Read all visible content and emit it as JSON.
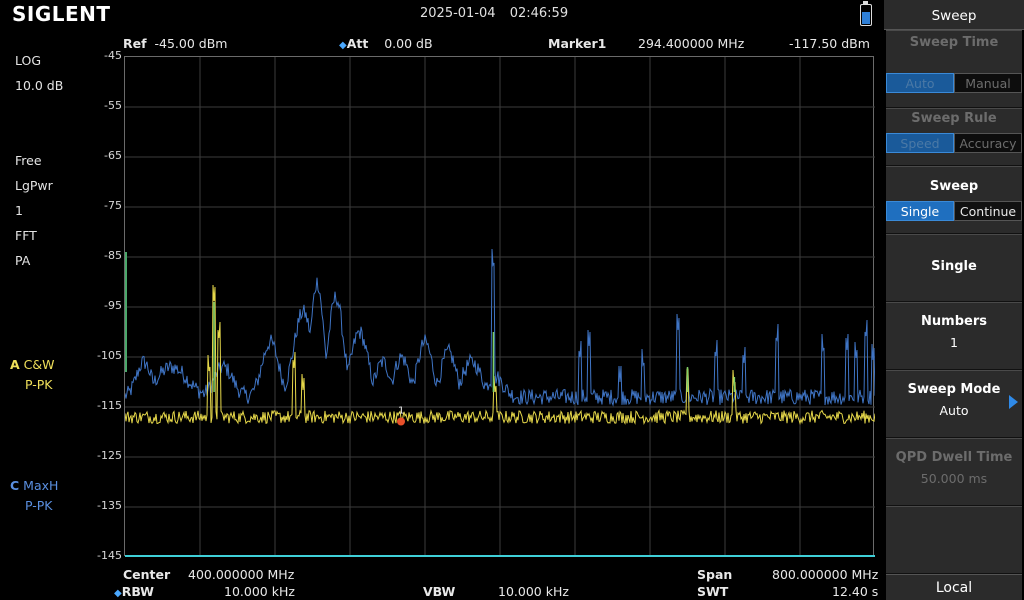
{
  "header": {
    "brand": "SIGLENT",
    "date": "2025-01-04",
    "time": "02:46:59"
  },
  "left_panel": {
    "scale_type": "LOG",
    "scale_div": "10.0 dB",
    "trigger": "Free",
    "detector": "LgPwr",
    "avg_count": "1",
    "mode": "FFT",
    "preamp": "PA",
    "traceA": {
      "letter": "A",
      "mode": "C&W",
      "detect": "P-PK",
      "color": "#f0e05a"
    },
    "traceC": {
      "letter": "C",
      "mode": "MaxH",
      "detect": "P-PK",
      "color": "#5a8fe0"
    }
  },
  "top_info": {
    "ref_label": "Ref",
    "ref_value": "-45.00 dBm",
    "att_label": "Att",
    "att_value": "0.00 dB",
    "marker_label": "Marker1",
    "marker_freq": "294.400000 MHz",
    "marker_level": "-117.50 dBm"
  },
  "yaxis": {
    "ticks": [
      "-45",
      "-55",
      "-65",
      "-75",
      "-85",
      "-95",
      "-105",
      "-115",
      "-125",
      "-135",
      "-145"
    ],
    "min": -145,
    "max": -45
  },
  "bottom": {
    "center_label": "Center",
    "center_value": "400.000000 MHz",
    "span_label": "Span",
    "span_value": "800.000000 MHz",
    "rbw_label": "RBW",
    "rbw_value": "10.000 kHz",
    "vbw_label": "VBW",
    "vbw_value": "10.000 kHz",
    "swt_label": "SWT",
    "swt_value": "12.40 s"
  },
  "marker": {
    "number": "1",
    "freq_mhz": 294.4,
    "level_dbm": -117.5,
    "color": "#e8502a"
  },
  "menu": {
    "title": "Sweep",
    "sweep_time": {
      "label": "Sweep Time",
      "options": [
        "Auto",
        "Manual"
      ],
      "selected": 0,
      "enabled": false
    },
    "sweep_rule": {
      "label": "Sweep Rule",
      "options": [
        "Speed",
        "Accuracy"
      ],
      "selected": 0,
      "enabled": false
    },
    "sweep": {
      "label": "Sweep",
      "options": [
        "Single",
        "Continue"
      ],
      "selected": 0,
      "enabled": true
    },
    "single": {
      "label": "Single"
    },
    "numbers": {
      "label": "Numbers",
      "value": "1"
    },
    "sweep_mode": {
      "label": "Sweep Mode",
      "value": "Auto"
    },
    "qpd": {
      "label": "QPD Dwell Time",
      "value": "50.000 ms",
      "enabled": false
    },
    "local": "Local"
  },
  "chart_data": {
    "type": "line",
    "x_range_mhz": [
      0,
      800
    ],
    "ylim": [
      -145,
      -45
    ],
    "grid": true,
    "series": [
      {
        "name": "C",
        "color": "#3f74c4",
        "baseline": -113,
        "peaks": [
          [
            20,
            -106,
            14
          ],
          [
            50,
            -107,
            30
          ],
          [
            105,
            -107,
            18
          ],
          [
            155,
            -102,
            16
          ],
          [
            190,
            -96,
            18
          ],
          [
            205,
            -90,
            12
          ],
          [
            225,
            -93,
            14
          ],
          [
            250,
            -100,
            16
          ],
          [
            275,
            -106,
            14
          ],
          [
            295,
            -105,
            14
          ],
          [
            320,
            -102,
            14
          ],
          [
            345,
            -104,
            14
          ],
          [
            370,
            -106,
            18
          ],
          [
            395,
            -109,
            16
          ]
        ],
        "spikes": [
          [
            393,
            -88
          ],
          [
            485,
            -106
          ],
          [
            495,
            -103
          ],
          [
            528,
            -110
          ],
          [
            553,
            -108
          ],
          [
            590,
            -100
          ],
          [
            600,
            -110
          ],
          [
            630,
            -106
          ],
          [
            660,
            -107
          ],
          [
            695,
            -103
          ],
          [
            745,
            -105
          ],
          [
            770,
            -104
          ],
          [
            780,
            -106
          ],
          [
            790,
            -102
          ],
          [
            798,
            -106
          ]
        ]
      },
      {
        "name": "A",
        "color": "#e6d84a",
        "baseline": -117,
        "spikes": [
          [
            90,
            -109
          ],
          [
            95,
            -94
          ],
          [
            100,
            -102
          ],
          [
            180,
            -108
          ],
          [
            190,
            -112
          ],
          [
            395,
            -113
          ],
          [
            600,
            -109
          ],
          [
            650,
            -112
          ]
        ]
      }
    ]
  }
}
